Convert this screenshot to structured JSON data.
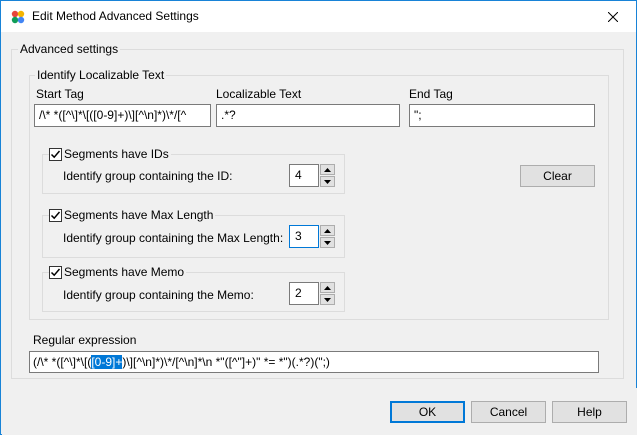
{
  "window": {
    "title": "Edit Method Advanced Settings",
    "border_color": "#1883d7"
  },
  "advanced": {
    "legend": "Advanced settings",
    "identify": {
      "legend": "Identify Localizable Text",
      "start_tag": {
        "label": "Start Tag",
        "value": "/\\* *([^\\]*\\[([0-9]+)\\][^\\n]*)\\*/[^"
      },
      "localizable_text": {
        "label": "Localizable Text",
        "value": ".*?"
      },
      "end_tag": {
        "label": "End Tag",
        "value": "\";"
      },
      "ids": {
        "checkbox_label": "Segments have IDs",
        "checked": true,
        "group_label": "Identify group containing the ID:",
        "group_value": "4"
      },
      "max_length": {
        "checkbox_label": "Segments have Max Length",
        "checked": true,
        "group_label": "Identify group containing the Max Length:",
        "group_value": "3"
      },
      "memo": {
        "checkbox_label": "Segments have Memo",
        "checked": true,
        "group_label": "Identify group containing the Memo:",
        "group_value": "2"
      },
      "clear_label": "Clear"
    },
    "regex": {
      "label": "Regular expression",
      "before_selection": "(/\\* *([^\\]*\\[(",
      "selection": "[0-9]+",
      "after_selection": ")\\][^\\n]*)\\*/[^\\n]*\\n *\"([^\"]+)\" *= *\")(.*?)(\";)"
    }
  },
  "buttons": {
    "ok": "OK",
    "cancel": "Cancel",
    "help": "Help"
  },
  "colors": {
    "accent": "#0078d7",
    "dialog_bg": "#f0f0f0"
  }
}
